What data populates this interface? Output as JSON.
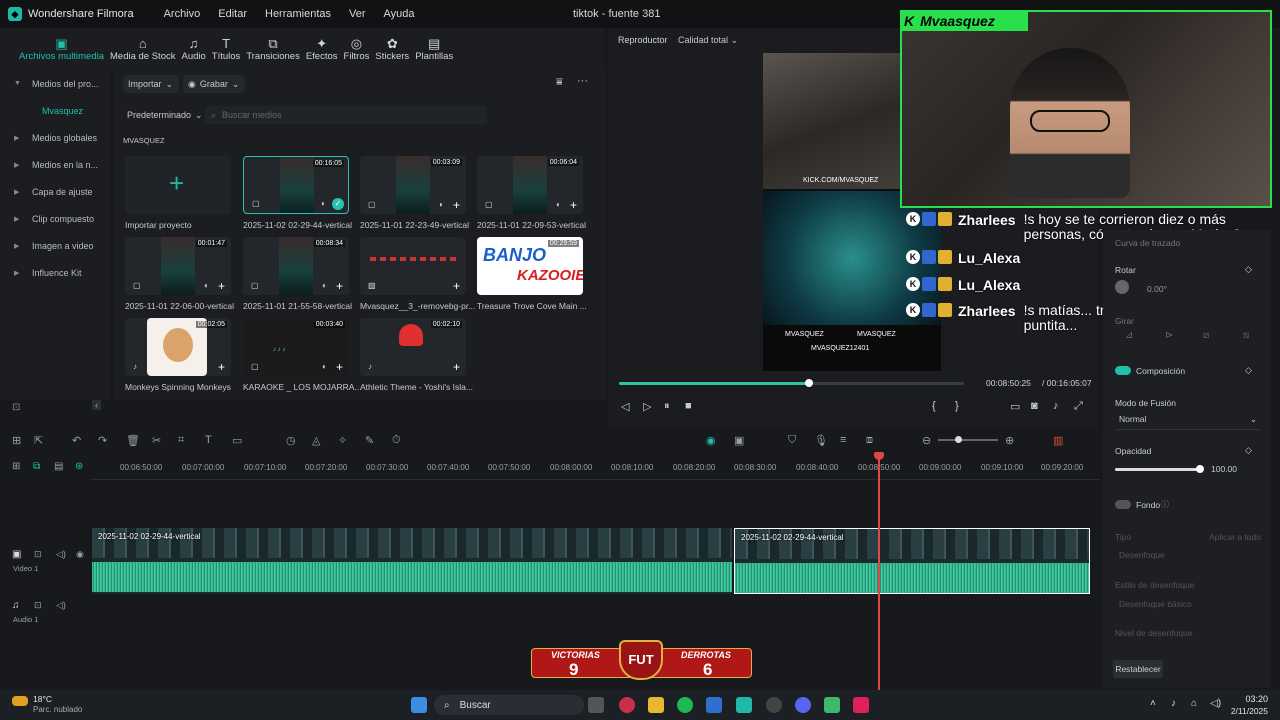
{
  "app": {
    "name": "Wondershare Filmora",
    "window_title": "tiktok - fuente 381"
  },
  "menu": [
    "Archivo",
    "Editar",
    "Herramientas",
    "Ver",
    "Ayuda"
  ],
  "toolbar": [
    {
      "label": "Archivos multimedia",
      "icon": "media-icon",
      "active": true
    },
    {
      "label": "Media de Stock",
      "icon": "stock-icon"
    },
    {
      "label": "Audio",
      "icon": "audio-icon"
    },
    {
      "label": "Títulos",
      "icon": "titles-icon"
    },
    {
      "label": "Transiciones",
      "icon": "transitions-icon"
    },
    {
      "label": "Efectos",
      "icon": "effects-icon"
    },
    {
      "label": "Filtros",
      "icon": "filters-icon"
    },
    {
      "label": "Stickers",
      "icon": "stickers-icon"
    },
    {
      "label": "Plantillas",
      "icon": "templates-icon"
    }
  ],
  "sidebar": {
    "items": [
      "Medios del pro...",
      "Mvasquez",
      "Medios globales",
      "Medios en la n...",
      "Capa de ajuste",
      "Clip compuesto",
      "Imagen a video",
      "Influence Kit"
    ]
  },
  "media": {
    "import_label": "Importar",
    "record_label": "Grabar",
    "sort_label": "Predeterminado",
    "search_placeholder": "Buscar medios",
    "folder": "MVASQUEZ",
    "items": [
      {
        "label": "Importar proyecto",
        "duration": ""
      },
      {
        "label": "2025-11-02 02-29-44-vertical",
        "duration": "00:16:05"
      },
      {
        "label": "2025-11-01 22-23-49-vertical",
        "duration": "00:03:09"
      },
      {
        "label": "2025-11-01 22-09-53-vertical",
        "duration": "00:06:04"
      },
      {
        "label": "2025-11-01 22-06-00-vertical",
        "duration": "00:01:47"
      },
      {
        "label": "2025-11-01 21-55-58-vertical",
        "duration": "00:08:34"
      },
      {
        "label": "Mvasquez__3_-removebg-pr...",
        "duration": ""
      },
      {
        "label": "Treasure Trove Cove   Main ...",
        "duration": "00:29:59"
      },
      {
        "label": "Monkeys Spinning Monkeys",
        "duration": "00:02:05"
      },
      {
        "label": "KARAOKE _ LOS MOJARRA...",
        "duration": "00:03:40"
      },
      {
        "label": "Athletic Theme - Yoshi's Isla...",
        "duration": "00:02:10"
      }
    ]
  },
  "player": {
    "tab": "Reproductor",
    "quality": "Calidad total",
    "current_time": "00:08:50:25",
    "total_time": "/ 00:16:05:07",
    "progress": 0.55
  },
  "overlay": {
    "channel": "Mvaasquez",
    "chat": [
      {
        "user": "Zharlees",
        "message": "!s hoy se te corrieron diez o más personas, cómo te sientes Matías?"
      },
      {
        "user": "Lu_Alexa",
        "message": ""
      },
      {
        "user": "Lu_Alexa",
        "message": ""
      },
      {
        "user": "Zharlees",
        "message": "!s matías... tres días más... la puntita..."
      }
    ],
    "video_handles": [
      "KICK.COM/MVASQUEZ",
      "MVASQUEZ",
      "MVASQUEZ",
      "MVASQUEZ12401"
    ]
  },
  "properties": {
    "curve_label": "Curva de trazado",
    "rotate_label": "Rotar",
    "rotate_value": "0.00°",
    "flip_label": "Girar",
    "composition_label": "Composición",
    "blend_label": "Modo de Fusión",
    "blend_value": "Normal",
    "opacity_label": "Opacidad",
    "opacity_value": "100.00",
    "background_label": "Fondo",
    "type_label": "Tipo",
    "apply_all_label": "Aplicar a todo",
    "type_value": "Desenfoque",
    "blur_style_label": "Estilo de desenfoque",
    "blur_style_value": "Desenfoque básico",
    "blur_level_label": "Nivel de desenfoque",
    "reset_label": "Restablecer"
  },
  "timeline": {
    "ruler": [
      "00:06:50:00",
      "00:07:00:00",
      "00:07:10:00",
      "00:07:20:00",
      "00:07:30:00",
      "00:07:40:00",
      "00:07:50:00",
      "00:08:00:00",
      "00:08:10:00",
      "00:08:20:00",
      "00:08:30:00",
      "00:08:40:00",
      "00:08:50:00",
      "00:09:00:00",
      "00:09:10:00",
      "00:09:20:00"
    ],
    "tracks": [
      {
        "label": "Video 1"
      },
      {
        "label": "Audio 1"
      }
    ],
    "clips": [
      "2025-11-02 02-29-44-vertical",
      "2025-11-02 02-29-44-vertical"
    ]
  },
  "scoreboard": {
    "wins_label": "VICTORIAS",
    "wins": "9",
    "badge": "FUT",
    "losses_label": "DERROTAS",
    "losses": "6"
  },
  "taskbar": {
    "temperature": "18°C",
    "weather": "Parc. nublado",
    "search": "Buscar",
    "time": "03:20",
    "date": "2/11/2025"
  }
}
